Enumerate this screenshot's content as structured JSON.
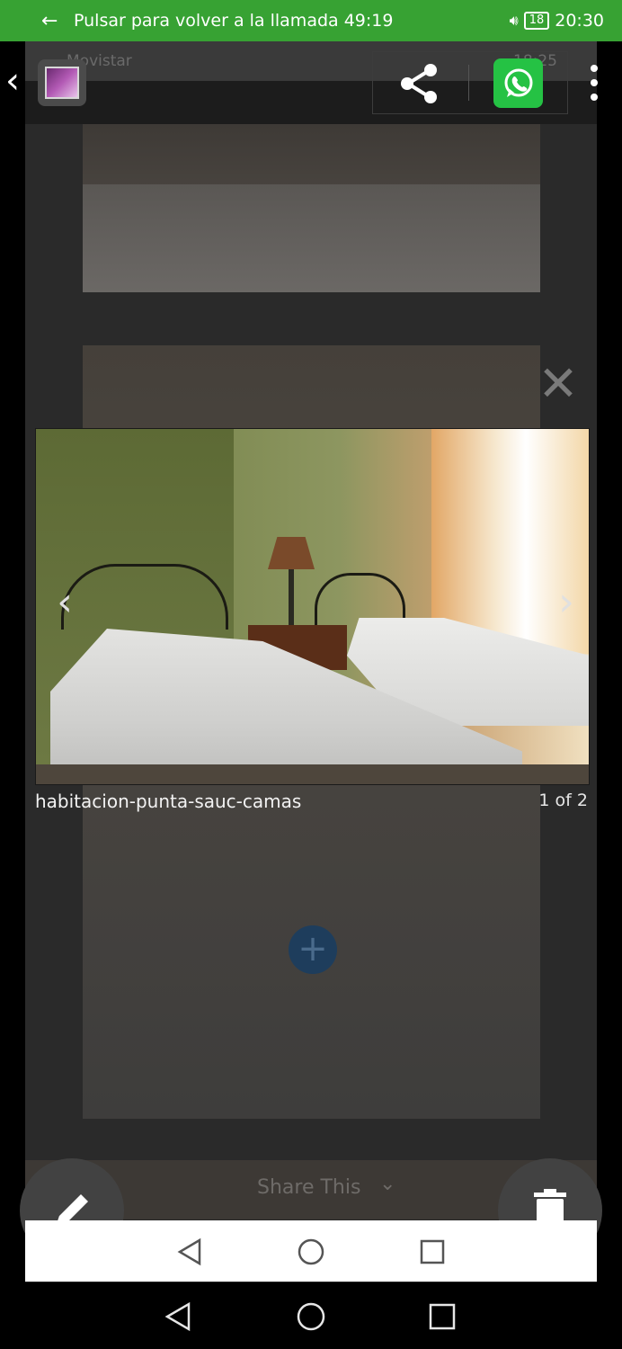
{
  "call_banner": {
    "back_glyph": "←",
    "text": "Pulsar para volver a la llamada 49:19",
    "battery": "18",
    "time": "20:30"
  },
  "underlying": {
    "carrier": "Movistar",
    "time": "18:25",
    "share_label": "Share This",
    "share_chevron": "⌄"
  },
  "toolbar": {
    "back_glyph": "‹",
    "icons": [
      "back-icon",
      "gallery-thumbnail",
      "share-icon",
      "whatsapp-icon",
      "more-vert-icon"
    ]
  },
  "lightbox": {
    "caption": "habitacion-punta-sauc-camas",
    "counter": "1 of 2",
    "close_glyph": "✕",
    "prev_glyph": "‹",
    "next_glyph": "›",
    "add_glyph": "+"
  },
  "fabs": {
    "edit": "pencil-icon",
    "delete": "trash-icon"
  },
  "system_nav": {
    "buttons": [
      "back-triangle-icon",
      "home-circle-icon",
      "recents-square-icon"
    ]
  }
}
